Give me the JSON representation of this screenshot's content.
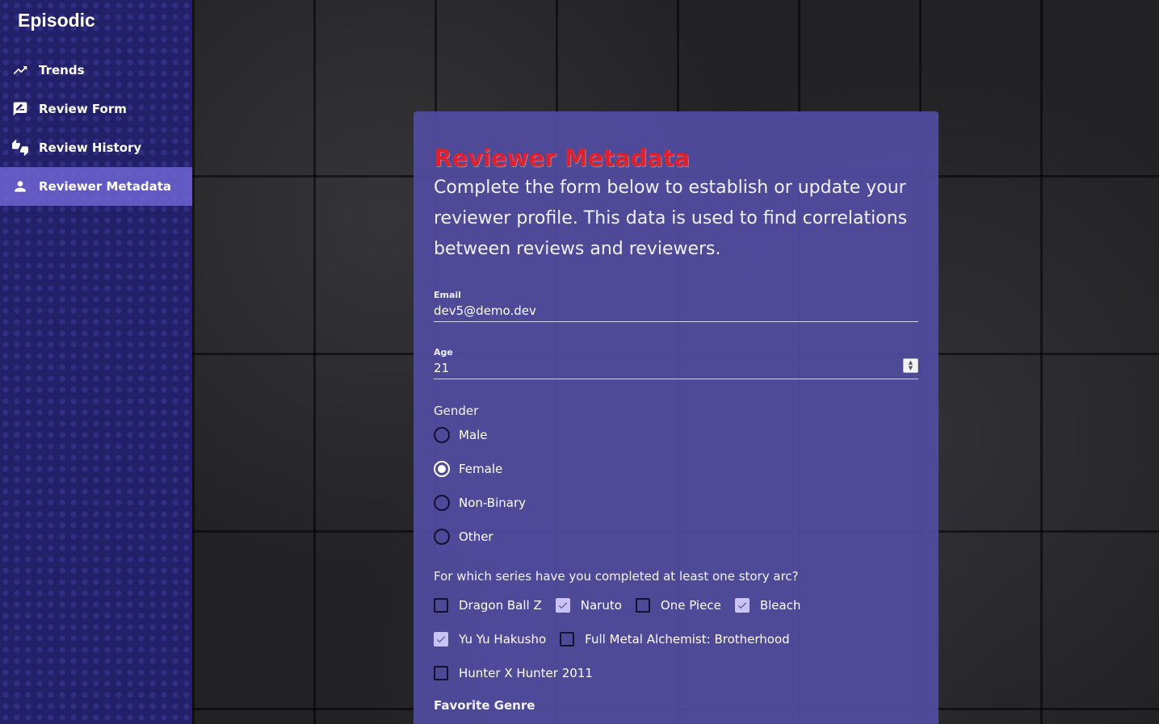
{
  "app": {
    "title": "Episodic"
  },
  "sidebar": {
    "items": [
      {
        "label": "Trends",
        "icon": "trending-up-icon",
        "active": false
      },
      {
        "label": "Review Form",
        "icon": "rate-review-icon",
        "active": false
      },
      {
        "label": "Review History",
        "icon": "thumbs-up-down-icon",
        "active": false
      },
      {
        "label": "Reviewer Metadata",
        "icon": "person-icon",
        "active": true
      }
    ]
  },
  "form": {
    "title": "Reviewer Metadata",
    "intro": "Complete the form below to establish or update your reviewer profile. This data is used to find correlations between reviews and reviewers.",
    "email": {
      "label": "Email",
      "value": "dev5@demo.dev"
    },
    "age": {
      "label": "Age",
      "value": "21"
    },
    "gender": {
      "label": "Gender",
      "options": [
        "Male",
        "Female",
        "Non-Binary",
        "Other"
      ],
      "selected": "Female"
    },
    "series": {
      "question": "For which series have you completed at least one story arc?",
      "options": [
        {
          "label": "Dragon Ball Z",
          "checked": false
        },
        {
          "label": "Naruto",
          "checked": true
        },
        {
          "label": "One Piece",
          "checked": false
        },
        {
          "label": "Bleach",
          "checked": true
        },
        {
          "label": "Yu Yu Hakusho",
          "checked": true
        },
        {
          "label": "Full Metal Alchemist: Brotherhood",
          "checked": false
        },
        {
          "label": "Hunter X Hunter 2011",
          "checked": false
        }
      ]
    },
    "favorite_genre": {
      "label": "Favorite Genre"
    }
  },
  "colors": {
    "sidebar_bg": "#23206a",
    "card_bg": "#524ca0",
    "title_red": "#e0202a",
    "active_nav": "#6e64d2"
  }
}
